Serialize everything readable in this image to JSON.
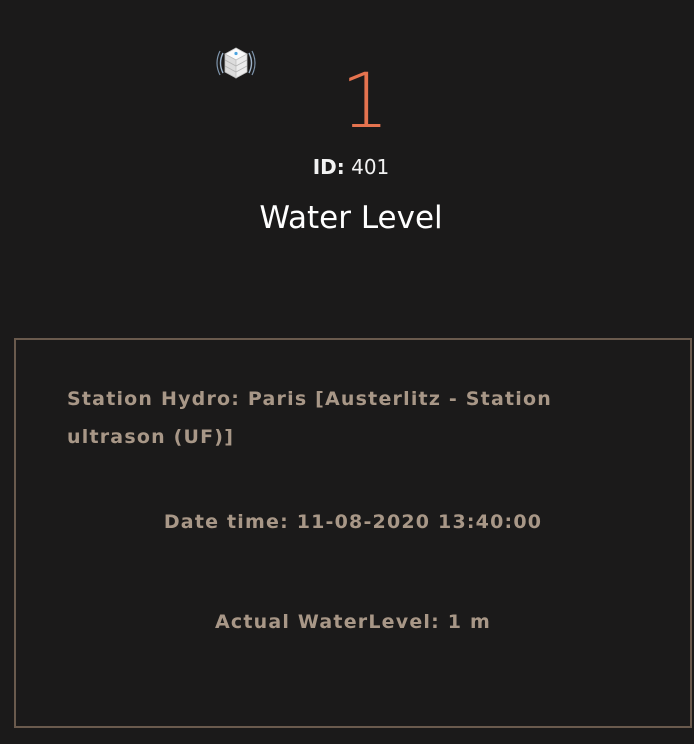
{
  "header": {
    "icon": "sensor-device-icon",
    "value": "1",
    "value_color": "#e5734f",
    "id_label": "ID:",
    "id_value": "401",
    "title": "Water Level"
  },
  "info": {
    "border_color": "#6a5a4d",
    "text_color": "#a89787",
    "station": "Station Hydro: Paris [Austerlitz - Station ultrason (UF)]",
    "datetime": "Date time: 11-08-2020 13:40:00",
    "waterlevel": "Actual WaterLevel: 1 m"
  }
}
